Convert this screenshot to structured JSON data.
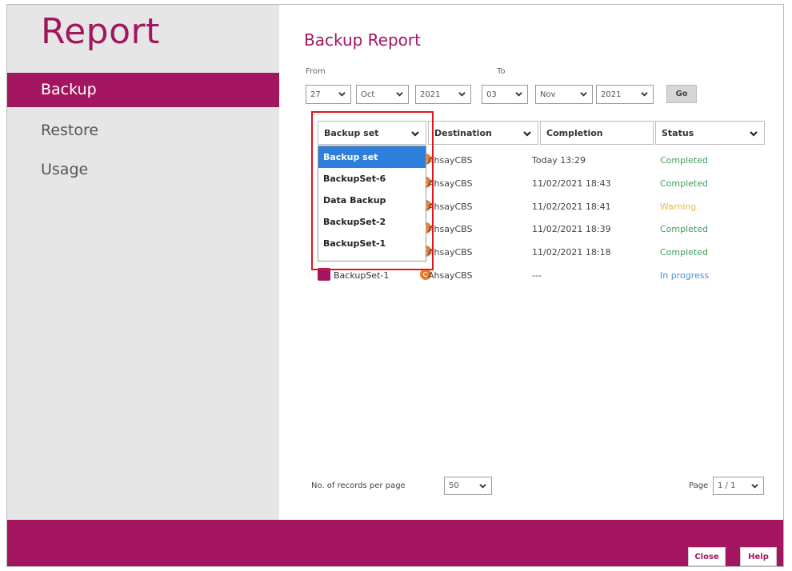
{
  "sidebar": {
    "title": "Report",
    "items": [
      {
        "label": "Backup",
        "active": true
      },
      {
        "label": "Restore",
        "active": false
      },
      {
        "label": "Usage",
        "active": false
      }
    ]
  },
  "main": {
    "title": "Backup Report",
    "from_label": "From",
    "to_label": "To",
    "from": {
      "day": "27",
      "month": "Oct",
      "year": "2021"
    },
    "to": {
      "day": "03",
      "month": "Nov",
      "year": "2021"
    },
    "go_label": "Go",
    "columns": [
      "Backup set",
      "Destination",
      "Completion",
      "Status"
    ],
    "rows": [
      {
        "name": "",
        "destination": "AhsayCBS",
        "completion": "Today 13:29",
        "status": "Completed"
      },
      {
        "name": "",
        "destination": "AhsayCBS",
        "completion": "11/02/2021 18:43",
        "status": "Completed"
      },
      {
        "name": "",
        "destination": "AhsayCBS",
        "completion": "11/02/2021 18:41",
        "status": "Warning"
      },
      {
        "name": "",
        "destination": "AhsayCBS",
        "completion": "11/02/2021 18:39",
        "status": "Completed"
      },
      {
        "name": "",
        "destination": "AhsayCBS",
        "completion": "11/02/2021 18:18",
        "status": "Completed"
      },
      {
        "name": "BackupSet-1",
        "destination": "AhsayCBS",
        "completion": "---",
        "status": "In progress"
      }
    ],
    "dropdown_options": [
      "Backup set",
      "BackupSet-6",
      "Data Backup",
      "BackupSet-2",
      "BackupSet-1"
    ],
    "records_per_page_label": "No. of records per page",
    "records_per_page": "50",
    "page_label": "Page",
    "page_value": "1 / 1"
  },
  "buttons": {
    "close": "Close",
    "help": "Help"
  },
  "colors": {
    "brand": "#a3165f",
    "completed": "#3da05a",
    "warning": "#f2b544",
    "in_progress": "#4a8fd6",
    "selected": "#2e7fdc",
    "highlight": "#e0161e"
  }
}
